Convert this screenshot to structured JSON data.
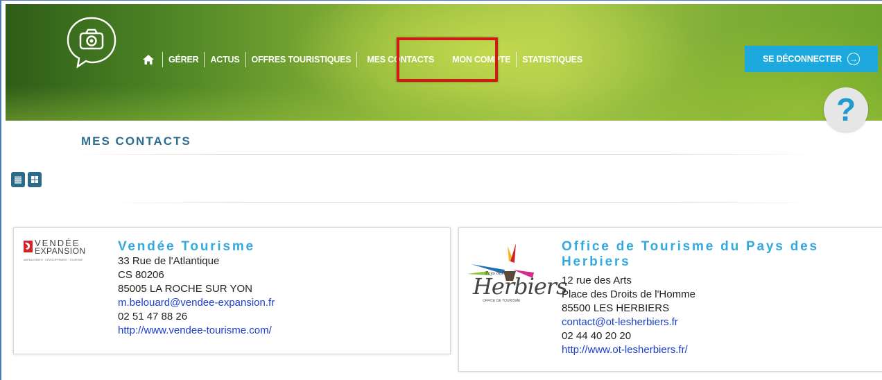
{
  "nav": {
    "items": [
      "GÉRER",
      "ACTUS",
      "OFFRES TOURISTIQUES",
      "MES CONTACTS",
      "MON COMPTE",
      "STATISTIQUES"
    ],
    "logout_label": "SE DÉCONNECTER",
    "help_label": "?"
  },
  "page": {
    "title": "MES CONTACTS"
  },
  "contacts": [
    {
      "name": "Vendée Tourisme",
      "logo_text": "VENDÉE",
      "logo_subtext": "EXPANSION",
      "logo_tagline": "AMÉNAGEMENT · DÉVELOPPEMENT · TOURISME",
      "address1": "33 Rue de l'Atlantique",
      "address2": "CS 80206",
      "city": "85005 LA ROCHE SUR YON",
      "email": "m.belouard@vendee-expansion.fr",
      "phone": "02 51 47 88 26",
      "website": "http://www.vendee-tourisme.com/"
    },
    {
      "name": "Office de Tourisme du Pays des Herbiers",
      "logo_text": "Herbiers",
      "logo_subtext": "Pays des",
      "logo_tagline": "OFFICE DE TOURISME",
      "address1": "12 rue des Arts",
      "address2": "Place des Droits de l'Homme",
      "city": "85500 LES HERBIERS",
      "email": "contact@ot-lesherbiers.fr",
      "phone": "02 44 40 20 20",
      "website": "http://www.ot-lesherbiers.fr/"
    }
  ],
  "colors": {
    "accent_blue": "#1da9dd",
    "title_teal": "#2b6d8e",
    "link_blue": "#1a3dcc",
    "highlight_red": "#d01a14"
  }
}
